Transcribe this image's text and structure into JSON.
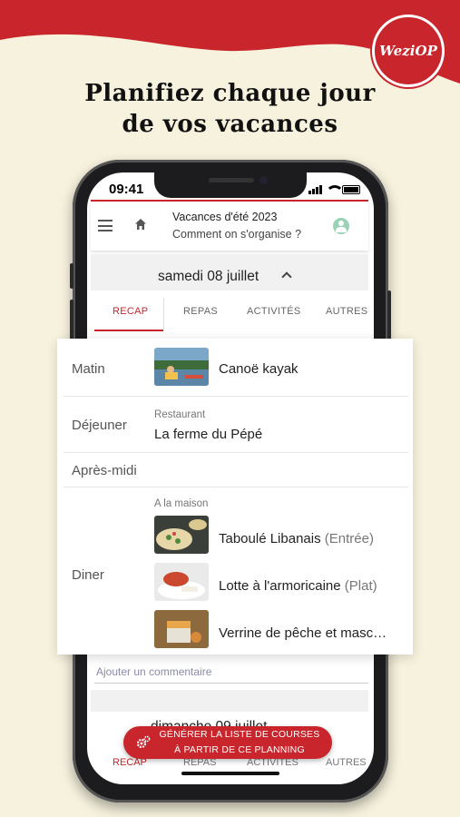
{
  "brand": {
    "logo_text": "WeziOP",
    "primary_color": "#c8262c",
    "background_color": "#f7f2de"
  },
  "headline": {
    "line1": "Planifiez chaque jour",
    "line2": "de vos vacances"
  },
  "status_bar": {
    "time": "09:41"
  },
  "app_bar": {
    "menu_icon": "menu-icon",
    "home_icon": "home-icon",
    "title": "Vacances d'été 2023",
    "subtitle": "Comment on s'organise ?",
    "account_icon": "account-icon"
  },
  "day": {
    "title": "samedi 08 juillet",
    "tabs": [
      {
        "label": "RECAP",
        "active": true
      },
      {
        "label": "REPAS",
        "active": false
      },
      {
        "label": "ACTIVITÉS",
        "active": false
      },
      {
        "label": "AUTRES",
        "active": false
      }
    ]
  },
  "recap": {
    "matin": {
      "label": "Matin",
      "item": "Canoë kayak"
    },
    "dejeuner": {
      "label": "Déjeuner",
      "place": "Restaurant",
      "item": "La ferme du Pépé"
    },
    "apres_midi": {
      "label": "Après-midi"
    },
    "diner": {
      "label": "Diner",
      "place": "A la maison",
      "items": [
        {
          "name": "Taboulé Libanais",
          "course": "(Entrée)"
        },
        {
          "name": "Lotte à l'armoricaine",
          "course": "(Plat)"
        },
        {
          "name": "Verrine de pêche et masc…",
          "course": ""
        }
      ]
    }
  },
  "comment_placeholder": "Ajouter un commentaire",
  "next_day": {
    "title": "dimanche 09 juillet",
    "tabs": [
      "RECAP",
      "REPAS",
      "ACTIVITÉS",
      "AUTRES"
    ]
  },
  "cta": {
    "line1": "GÉNÉRER LA LISTE DE COURSES",
    "line2": "À PARTIR DE CE PLANNING",
    "icon": "gears-icon"
  }
}
